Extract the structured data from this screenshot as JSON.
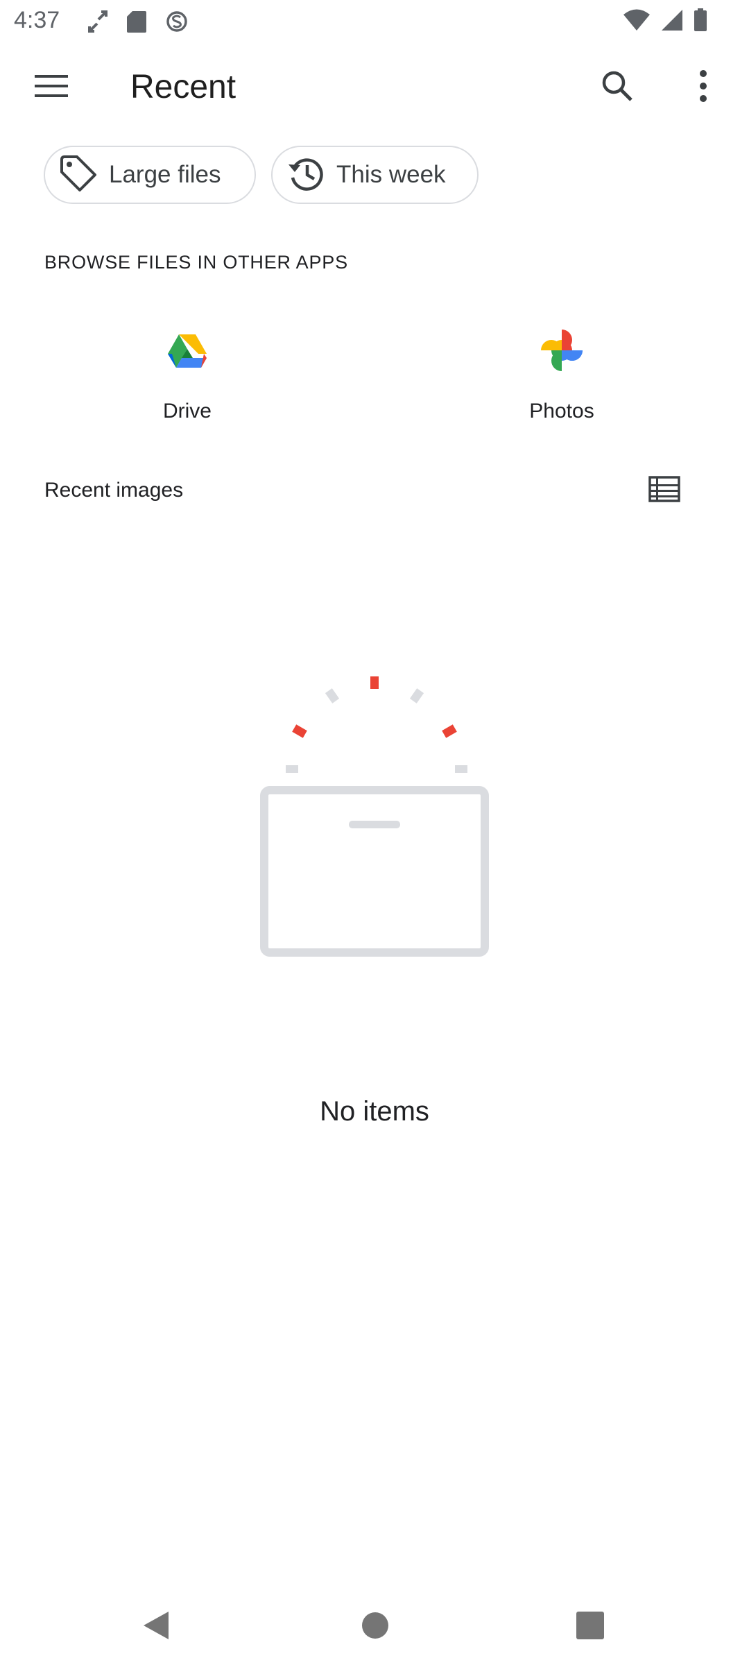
{
  "status_bar": {
    "time": "4:37",
    "left_icons": [
      "expand-arrows-icon",
      "sd-card-icon",
      "s-notification-icon"
    ],
    "right_icons": [
      "wifi-icon",
      "cell-signal-icon",
      "battery-icon"
    ]
  },
  "app_bar": {
    "title": "Recent",
    "menu_icon": "hamburger-menu-icon",
    "search_icon": "search-icon",
    "more_icon": "more-vert-icon"
  },
  "chips": [
    {
      "label": "Large files",
      "icon": "tag-icon"
    },
    {
      "label": "This week",
      "icon": "history-icon"
    }
  ],
  "browse": {
    "header": "BROWSE FILES IN OTHER APPS",
    "apps": [
      {
        "label": "Drive",
        "icon": "google-drive-icon"
      },
      {
        "label": "Photos",
        "icon": "google-photos-icon"
      }
    ]
  },
  "recent_images": {
    "header": "Recent images",
    "view_toggle_icon": "list-view-icon",
    "empty_text": "No items"
  },
  "nav_bar": {
    "back_icon": "back-triangle-icon",
    "home_icon": "home-circle-icon",
    "recents_icon": "recents-square-icon"
  },
  "colors": {
    "icon_gray": "#5f6368",
    "chip_border": "#dadce0",
    "illustration_red": "#ea4335",
    "illustration_gray": "#dadce0",
    "nav_gray": "#757575"
  }
}
